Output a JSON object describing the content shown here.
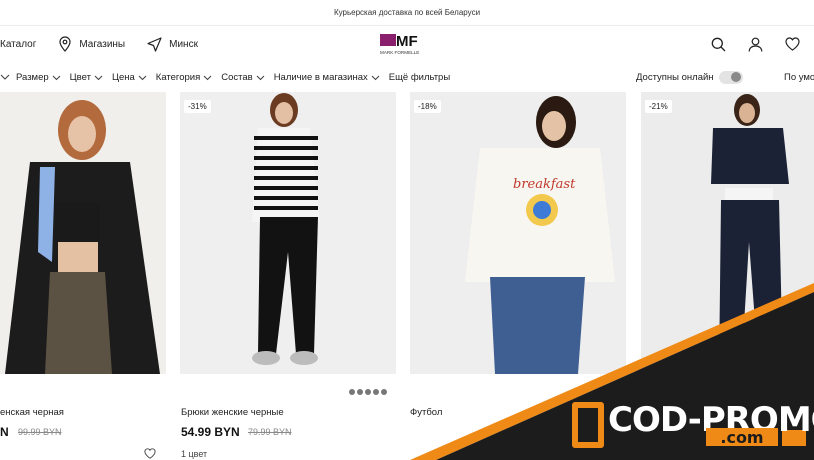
{
  "announcement": "Курьерская доставка по всей Беларуси",
  "header": {
    "catalog": "Каталог",
    "stores": "Магазины",
    "city": "Минск",
    "logo_initials": "MF",
    "logo_text": "MARK FORMELLE"
  },
  "filters": {
    "items": [
      "Размер",
      "Цвет",
      "Цена",
      "Категория",
      "Состав",
      "Наличие в магазинах"
    ],
    "more": "Ещё фильтры",
    "online": "Доступны онлайн",
    "sort": "По умо"
  },
  "products": [
    {
      "badge": "",
      "name": "енская черная",
      "price": "N",
      "old_price": "99.99 BYN"
    },
    {
      "badge": "-31%",
      "name": "Брюки женские черные",
      "price": "54.99 BYN",
      "old_price": "79.99 BYN",
      "colors": "1 цвет"
    },
    {
      "badge": "-18%",
      "name": "Футбол",
      "price": "",
      "old_price": ""
    },
    {
      "badge": "-21%",
      "name": "",
      "price": "",
      "old_price": ""
    }
  ],
  "promo": {
    "main": "COD-PROMO",
    "sub": ".com"
  },
  "colors": {
    "accent": "#f08a16",
    "banner_dark": "#1c1c1c",
    "logo": "#8a1f6e"
  }
}
